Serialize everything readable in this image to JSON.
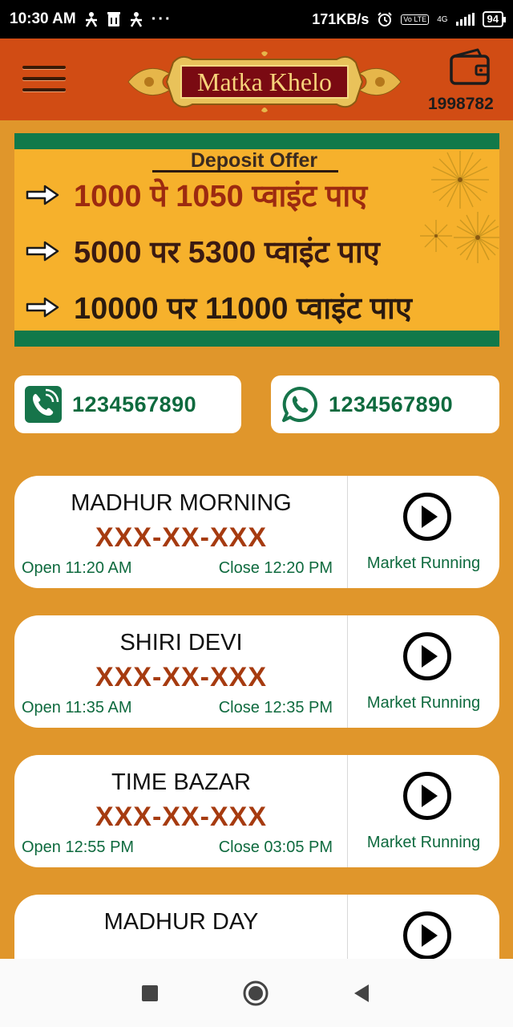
{
  "status_bar": {
    "time": "10:30 AM",
    "icons": [
      "person-icon",
      "storage-icon",
      "person-icon"
    ],
    "dots": "···",
    "speed": "171KB/s",
    "volte": "Vo LTE",
    "network": "4G",
    "battery": "94"
  },
  "header": {
    "menu_icon": "menu-icon",
    "logo_text": "Matka Khelo",
    "wallet_icon": "wallet-icon",
    "wallet_balance": "1998782"
  },
  "banner": {
    "title": "Deposit Offer",
    "offers": [
      "1000 पे 1050 प्वाइंट पाए",
      "5000 पर 5300 प्वाइंट पाए",
      "10000 पर 11000 प्वाइंट पाए"
    ],
    "colors": {
      "green": "#11794a",
      "background": "#f6b12c"
    }
  },
  "contacts": {
    "phone": {
      "number": "1234567890",
      "icon": "phone-icon"
    },
    "whatsapp": {
      "number": "1234567890",
      "icon": "whatsapp-icon"
    }
  },
  "markets": [
    {
      "name": "MADHUR MORNING",
      "result": "XXX-XX-XXX",
      "open": "Open 11:20 AM",
      "close": "Close 12:20 PM",
      "status": "Market Running"
    },
    {
      "name": "SHIRI DEVI",
      "result": "XXX-XX-XXX",
      "open": "Open 11:35 AM",
      "close": "Close 12:35 PM",
      "status": "Market Running"
    },
    {
      "name": "TIME BAZAR",
      "result": "XXX-XX-XXX",
      "open": "Open 12:55 PM",
      "close": "Close 03:05 PM",
      "status": "Market Running"
    },
    {
      "name": "MADHUR DAY"
    }
  ],
  "nav_bar": {
    "icons": [
      "recents-icon",
      "home-icon",
      "back-icon"
    ]
  },
  "colors": {
    "header": "#d14c14",
    "body": "#e0962b",
    "accent_green": "#0e6a3e",
    "result_red": "#a63b10"
  }
}
